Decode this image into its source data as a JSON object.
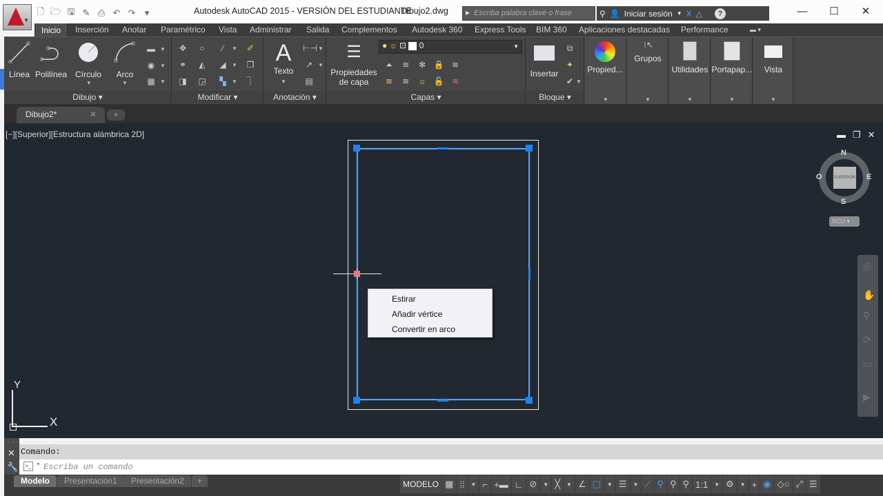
{
  "titlebar": {
    "app_title": "Autodesk AutoCAD 2015 - VERSIÓN DEL ESTUDIANTE",
    "file_name": "Dibujo2.dwg",
    "search_placeholder": "Escriba palabra clave o frase",
    "signin_label": "Iniciar sesión",
    "quick_access": [
      "new-icon",
      "open-icon",
      "save-icon",
      "save-as-icon",
      "plot-icon",
      "undo-icon",
      "redo-icon",
      "customize-icon"
    ]
  },
  "ribbon_tabs": [
    {
      "label": "Inicio",
      "active": true
    },
    {
      "label": "Inserción"
    },
    {
      "label": "Anotar"
    },
    {
      "label": "Paramétrico"
    },
    {
      "label": "Vista"
    },
    {
      "label": "Administrar"
    },
    {
      "label": "Salida"
    },
    {
      "label": "Complementos"
    },
    {
      "label": "Autodesk 360"
    },
    {
      "label": "Express Tools"
    },
    {
      "label": "BIM 360"
    },
    {
      "label": "Aplicaciones destacadas"
    },
    {
      "label": "Performance"
    }
  ],
  "ribbon": {
    "dibujo": {
      "title": "Dibujo",
      "buttons": [
        "Línea",
        "Polilínea",
        "Círculo",
        "Arco"
      ]
    },
    "modificar": {
      "title": "Modificar"
    },
    "anotacion": {
      "title": "Anotación",
      "buttons": [
        "Texto"
      ]
    },
    "capas": {
      "title": "Capas",
      "buttons": [
        "Propiedades de capa"
      ],
      "current_layer": "0"
    },
    "bloque": {
      "title": "Bloque",
      "buttons": [
        "Insertar"
      ]
    },
    "propiedades": {
      "label": "Propied..."
    },
    "grupos": {
      "label": "Grupos"
    },
    "utilidades": {
      "label": "Utilidades"
    },
    "portapapeles": {
      "label": "Portapap..."
    },
    "vista": {
      "label": "Vista"
    }
  },
  "doc_tabs": [
    {
      "label": "Dibujo2*",
      "active": true
    }
  ],
  "viewport": {
    "label": "[−][Superior][Estructura alámbrica 2D]",
    "viewcube": {
      "face": "SUPERIOR",
      "n": "N",
      "s": "S",
      "e": "E",
      "w": "O",
      "ucs": "SCU"
    }
  },
  "ucs_icon": {
    "x": "X",
    "y": "Y"
  },
  "context_menu": {
    "items": [
      "Estirar",
      "Añadir vértice",
      "Convertir en arco"
    ]
  },
  "command": {
    "history": "Comando:",
    "placeholder": "Escriba un comando"
  },
  "layout_tabs": [
    {
      "label": "Modelo",
      "active": true
    },
    {
      "label": "Presentación1"
    },
    {
      "label": "Presentación2"
    }
  ],
  "status": {
    "model_label": "MODELO",
    "scale": "1:1"
  },
  "colors": {
    "accent": "#1e82f0",
    "canvas": "#212830",
    "ribbon": "#464646"
  }
}
